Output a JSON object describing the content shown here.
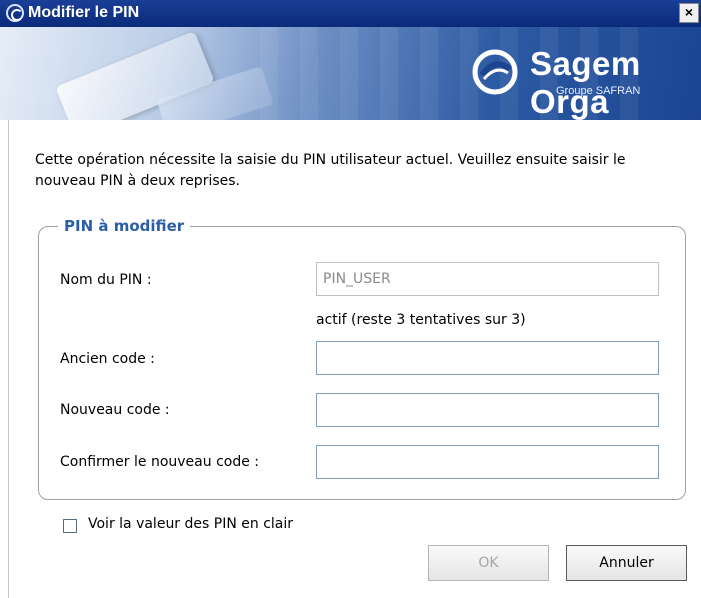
{
  "window": {
    "title": "Modifier le PIN",
    "close_glyph": "×"
  },
  "banner": {
    "brand_name": "Sagem Orga",
    "brand_subtitle": "Groupe SAFRAN"
  },
  "description": "Cette opération nécessite la saisie du PIN utilisateur actuel. Veuillez ensuite saisir le nouveau PIN à deux reprises.",
  "group": {
    "title": "PIN à modifier",
    "pin_name_label": "Nom du PIN :",
    "pin_name_value": "PIN_USER",
    "status_text": "actif (reste 3 tentatives sur 3)",
    "old_code_label": "Ancien code :",
    "new_code_label": "Nouveau code :",
    "confirm_code_label": "Confirmer le nouveau code :"
  },
  "show_pin_checkbox": {
    "label": "Voir la valeur des PIN en clair",
    "checked": false
  },
  "buttons": {
    "ok_label": "OK",
    "cancel_label": "Annuler"
  },
  "icons": {
    "title_icon": "sagem-logo-icon",
    "brand_logo": "sagem-swirl-logo-icon",
    "close": "close-icon"
  }
}
